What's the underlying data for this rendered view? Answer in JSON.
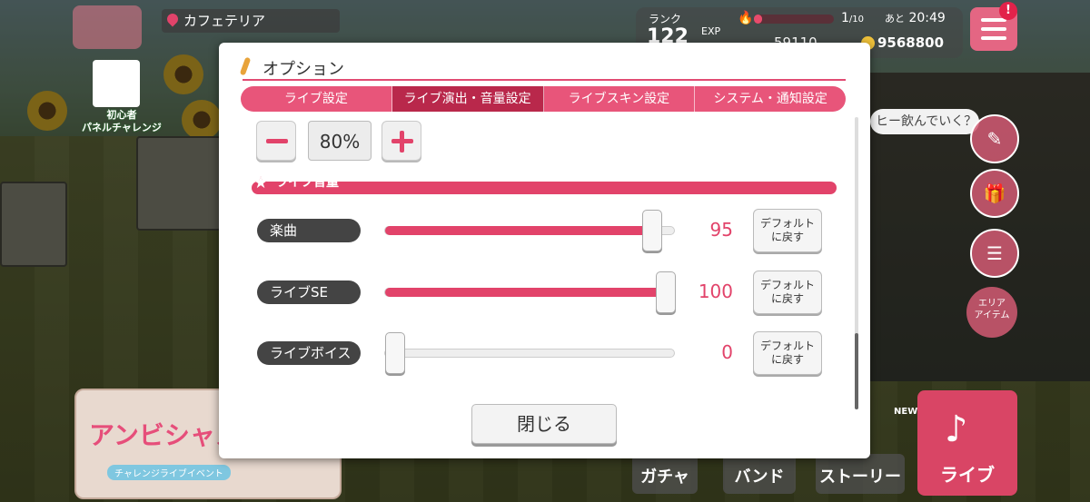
{
  "hud": {
    "location": "カフェテリア",
    "panel_label_1": "初心者",
    "panel_label_2": "パネルチャレンジ",
    "rank_label": "ランク",
    "rank_value": "122",
    "exp_label": "EXP",
    "stamina_current": "1",
    "stamina_max": "/10",
    "timer_prefix": "あと",
    "timer": "20:49",
    "star_count": "59110",
    "coin_count": "9568800",
    "notification": "!",
    "area_item_1": "エリア",
    "area_item_2": "アイテム",
    "speech_bubble": "ヒー飲んでいく？",
    "new_tag": "NEW"
  },
  "event_banner": {
    "title": "アンビシャス!",
    "subtitle": "チャレンジライブイベント"
  },
  "bottom_nav": {
    "gacha": "ガチャ",
    "band": "バンド",
    "story": "ストーリー",
    "live": "ライブ",
    "live_icon": "♪"
  },
  "modal": {
    "title": "オプション",
    "tabs": [
      {
        "label": "ライブ設定",
        "active": false
      },
      {
        "label": "ライブ演出・音量設定",
        "active": true
      },
      {
        "label": "ライブスキン設定",
        "active": false
      },
      {
        "label": "システム・通知設定",
        "active": false
      }
    ],
    "percent_value": "80%",
    "section_title": "ライブ音量",
    "sliders": [
      {
        "label": "楽曲",
        "value": "95",
        "fraction": 0.95,
        "default_label_1": "デフォルト",
        "default_label_2": "に戻す"
      },
      {
        "label": "ライブSE",
        "value": "100",
        "fraction": 1.0,
        "default_label_1": "デフォルト",
        "default_label_2": "に戻す"
      },
      {
        "label": "ライブボイス",
        "value": "0",
        "fraction": 0.0,
        "default_label_1": "デフォルト",
        "default_label_2": "に戻す"
      }
    ],
    "close_label": "閉じる"
  },
  "colors": {
    "accent": "#e2436a",
    "tab_active": "#b9284b"
  },
  "icons": [
    "map-icon",
    "pin-icon",
    "panel-icon",
    "flame-icon",
    "coin-icon",
    "menu-icon",
    "pen-icon",
    "gift-icon",
    "list-icon",
    "brush-icon",
    "star-icon",
    "minus-icon",
    "plus-icon"
  ]
}
